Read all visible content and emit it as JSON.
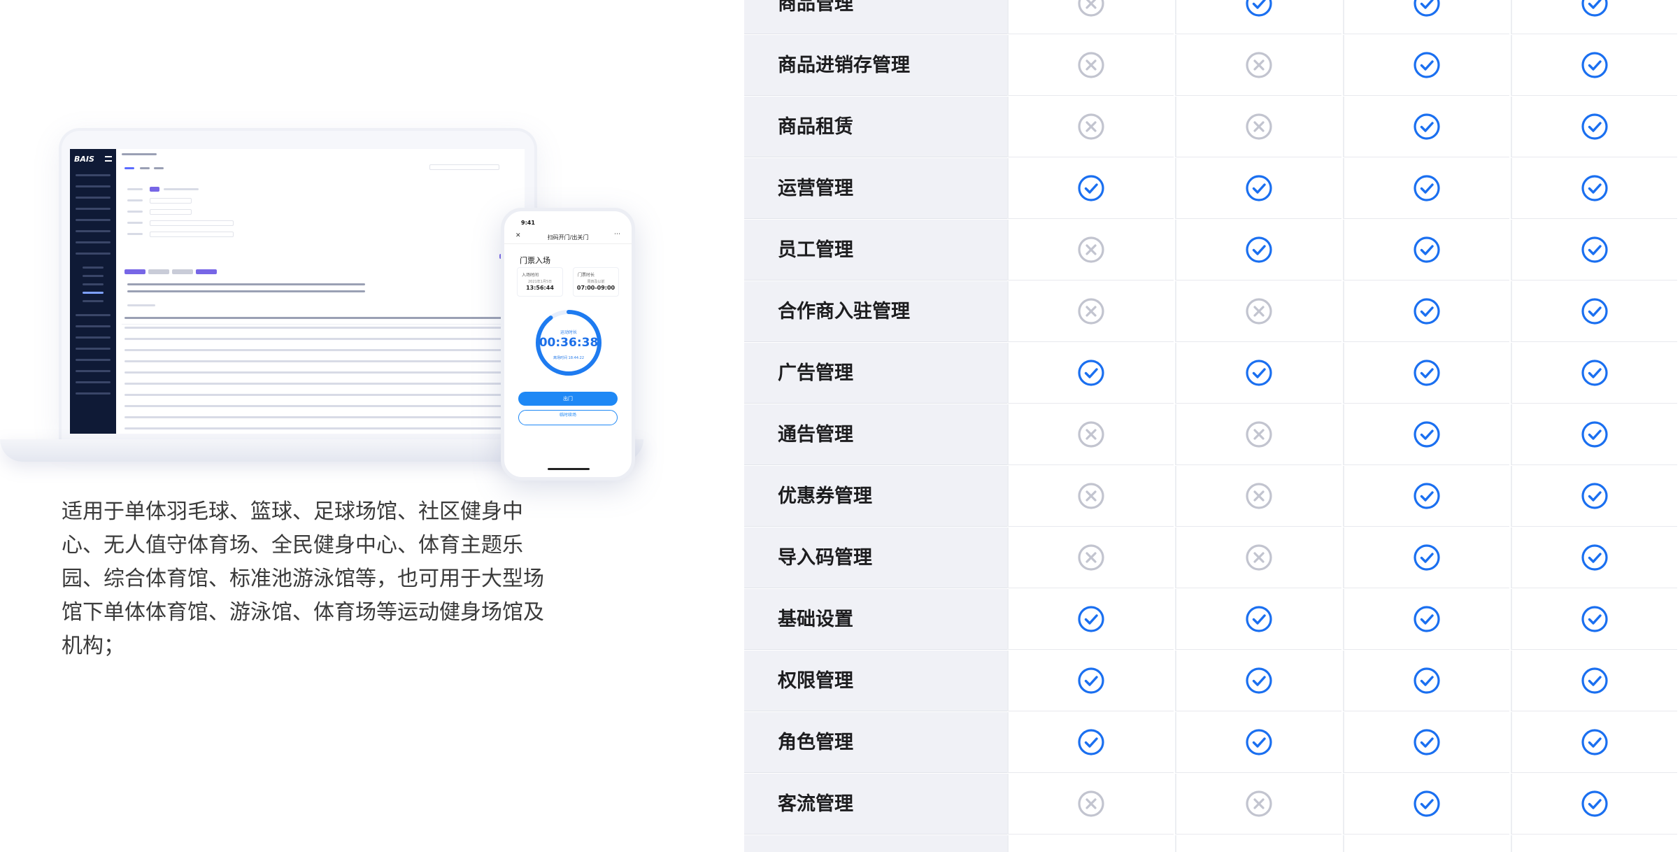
{
  "description": "适用于单体羽毛球、篮球、足球场馆、社区健身中心、无人值守体育场、全民健身中心、体育主题乐园、综合体育馆、标准池游泳馆等，也可用于大型场馆下单体体育馆、游泳馆、体育场等运动健身场馆及机构；",
  "laptop_app": {
    "logo": "BAIS",
    "menu_icon": "hamburger-icon"
  },
  "phone_app": {
    "time": "9:41",
    "title": "扫码开门/出关门",
    "close_icon": "close-icon",
    "more_icon": "more-dots-icon",
    "heading": "门票入场",
    "entry_time_label": "入场时间",
    "entry_date": "2021年1月5日",
    "entry_time": "13:56:44",
    "ticket_label": "门票时长",
    "ticket_sub": "周四及以前",
    "ticket_time": "07:00-09:00",
    "ring_label": "运动时长",
    "ring_time": "00:36:38",
    "ring_sub": "离场时间 18:44:22",
    "ring_progress": 0.9,
    "btn_open": "出门",
    "btn_renew": "临时续场"
  },
  "table": {
    "check_color": "#1a6ff0",
    "cross_color": "#c2c4cf",
    "rows": [
      {
        "name": "商品管理",
        "values": [
          false,
          true,
          true,
          true
        ]
      },
      {
        "name": "商品进销存管理",
        "values": [
          false,
          false,
          true,
          true
        ]
      },
      {
        "name": "商品租赁",
        "values": [
          false,
          false,
          true,
          true
        ]
      },
      {
        "name": "运营管理",
        "values": [
          true,
          true,
          true,
          true
        ]
      },
      {
        "name": "员工管理",
        "values": [
          false,
          true,
          true,
          true
        ]
      },
      {
        "name": "合作商入驻管理",
        "values": [
          false,
          false,
          true,
          true
        ]
      },
      {
        "name": "广告管理",
        "values": [
          true,
          true,
          true,
          true
        ]
      },
      {
        "name": "通告管理",
        "values": [
          false,
          false,
          true,
          true
        ]
      },
      {
        "name": "优惠券管理",
        "values": [
          false,
          false,
          true,
          true
        ]
      },
      {
        "name": "导入码管理",
        "values": [
          false,
          false,
          true,
          true
        ]
      },
      {
        "name": "基础设置",
        "values": [
          true,
          true,
          true,
          true
        ]
      },
      {
        "name": "权限管理",
        "values": [
          true,
          true,
          true,
          true
        ]
      },
      {
        "name": "角色管理",
        "values": [
          true,
          true,
          true,
          true
        ]
      },
      {
        "name": "客流管理",
        "values": [
          false,
          false,
          true,
          true
        ]
      }
    ]
  }
}
